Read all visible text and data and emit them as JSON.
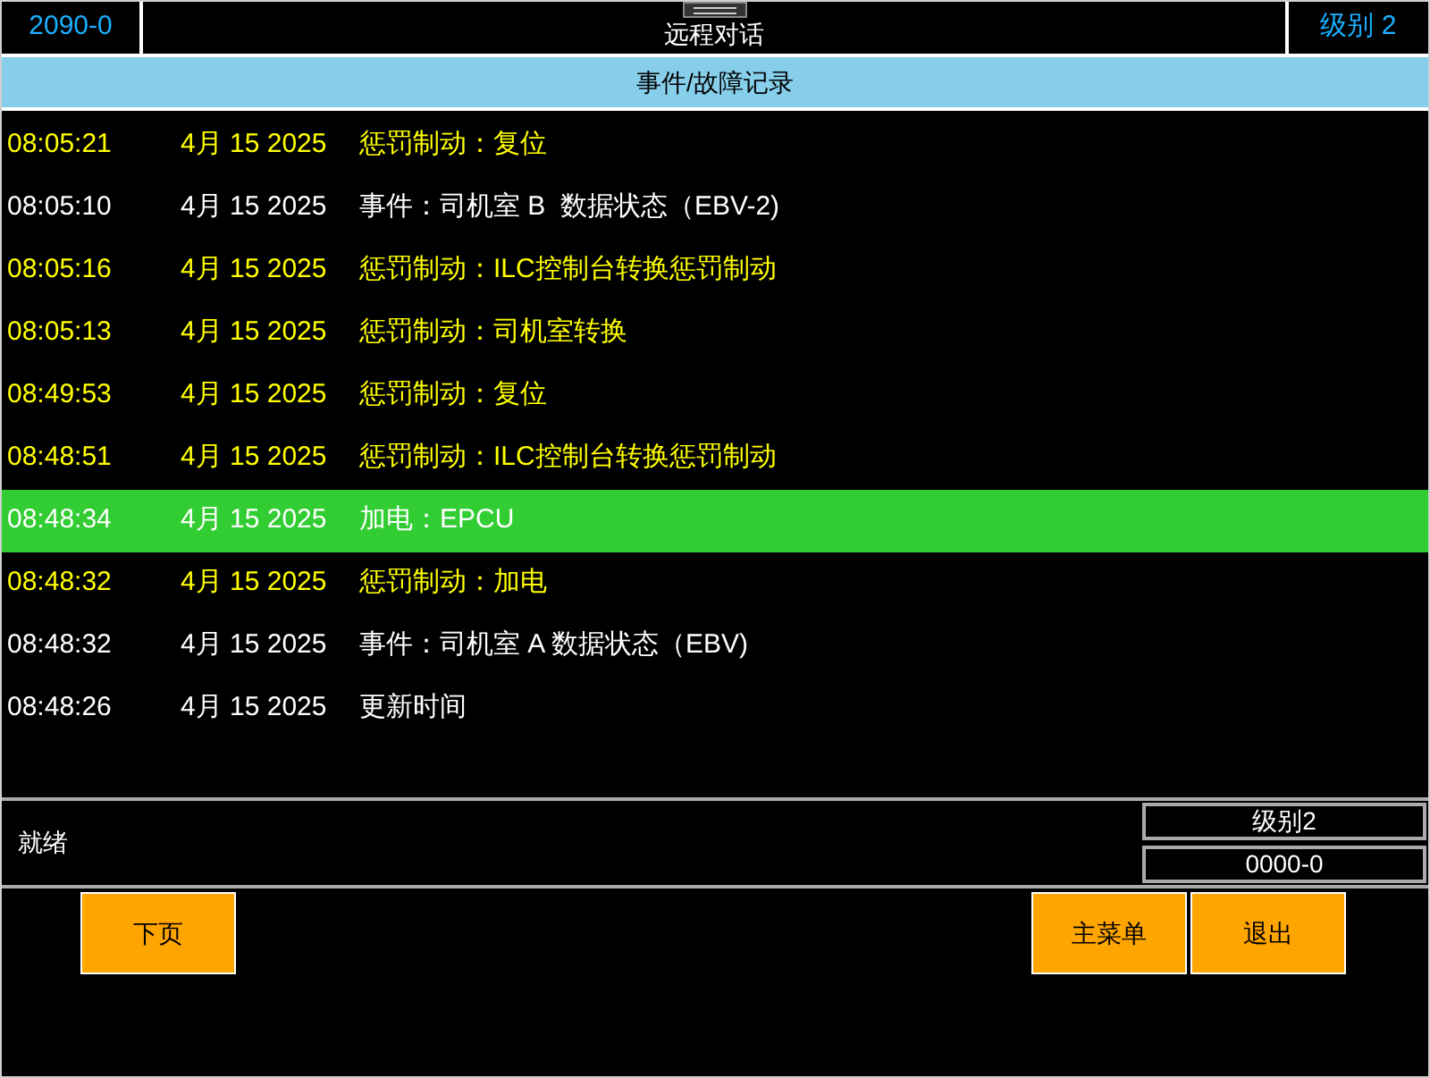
{
  "top_bar": {
    "left": "2090-0",
    "title": "远程对话",
    "right": "级别 2"
  },
  "header": "事件/故障记录",
  "rows": [
    {
      "time": "08:05:21",
      "date": "4月 15 2025",
      "text": "惩罚制动：复位",
      "color": "#ffff00",
      "selected": false
    },
    {
      "time": "08:05:10",
      "date": "4月 15 2025",
      "text": "事件：司机室 B  数据状态（EBV-2)",
      "color": "#ffffff",
      "selected": false
    },
    {
      "time": "08:05:16",
      "date": "4月 15 2025",
      "text": "惩罚制动：ILC控制台转换惩罚制动",
      "color": "#ffff00",
      "selected": false
    },
    {
      "time": "08:05:13",
      "date": "4月 15 2025",
      "text": "惩罚制动：司机室转换",
      "color": "#ffff00",
      "selected": false
    },
    {
      "time": "08:49:53",
      "date": "4月 15 2025",
      "text": "惩罚制动：复位",
      "color": "#ffff00",
      "selected": false
    },
    {
      "time": "08:48:51",
      "date": "4月 15 2025",
      "text": "惩罚制动：ILC控制台转换惩罚制动",
      "color": "#ffff00",
      "selected": false
    },
    {
      "time": "08:48:34",
      "date": "4月 15 2025",
      "text": "加电：EPCU",
      "color": "#ffffff",
      "selected": true
    },
    {
      "time": "08:48:32",
      "date": "4月 15 2025",
      "text": "惩罚制动：加电",
      "color": "#ffff00",
      "selected": false
    },
    {
      "time": "08:48:32",
      "date": "4月 15 2025",
      "text": "事件：司机室 A 数据状态（EBV)",
      "color": "#ffffff",
      "selected": false
    },
    {
      "time": "08:48:26",
      "date": "4月 15 2025",
      "text": "更新时间",
      "color": "#ffffff",
      "selected": false
    }
  ],
  "status_bar": {
    "message": "就绪",
    "level": "级别2",
    "code": "0000-0"
  },
  "buttons_left": [
    "下页"
  ],
  "buttons_right": [
    "主菜单",
    "退出"
  ]
}
